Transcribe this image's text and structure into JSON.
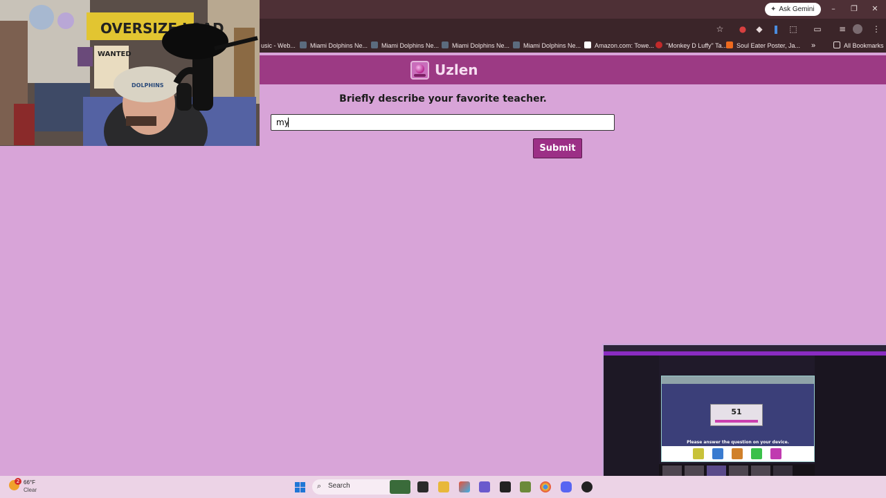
{
  "browser": {
    "ask_gemini": "Ask Gemini",
    "bookmarks": [
      "usic - Web...",
      "Miami Dolphins Ne...",
      "Miami Dolphins Ne...",
      "Miami Dolphins Ne...",
      "Miami Dolphins Ne...",
      "Amazon.com: Towe...",
      "\"Monkey D Luffy\" Ta...",
      "Soul Eater Poster, Ja..."
    ],
    "overflow_label": "»",
    "all_bookmarks": "All Bookmarks"
  },
  "page": {
    "site_title": "Uzlen",
    "prompt": "Briefly describe your favorite teacher.",
    "answer_value": "my",
    "submit_label": "Submit",
    "background_color": "#d8a4d8",
    "header_color": "#9c3a84",
    "button_color": "#9c2f86"
  },
  "webcam": {
    "sign_text": "OVERSIZE LOAD",
    "poster_text": "WANTED",
    "cap_text": "DOLPHINS"
  },
  "taskbar": {
    "weather_badge": "2",
    "weather_temp": "66°F",
    "weather_condition": "Clear",
    "search_placeholder": "Search"
  },
  "stream_overlay": {
    "score": "51",
    "question": "Please answer the question on your device."
  }
}
